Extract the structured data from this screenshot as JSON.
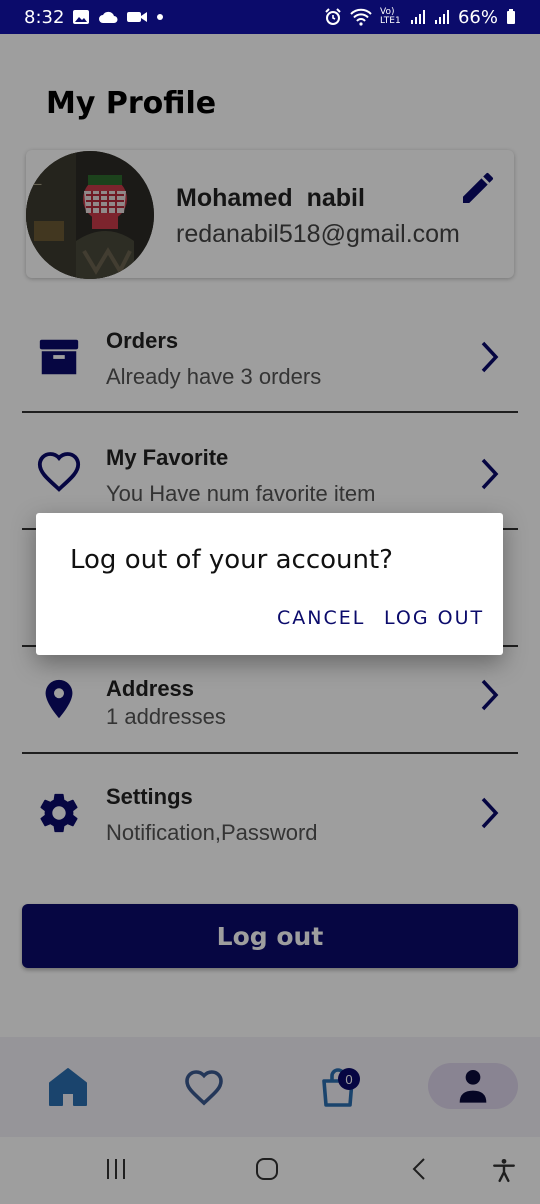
{
  "status_bar": {
    "time": "8:32",
    "battery": "66%",
    "network_label": "Vo) LTE1"
  },
  "page": {
    "title": "My Profile"
  },
  "profile": {
    "name": "Mohamed  nabil",
    "email": "redanabil518@gmail.com"
  },
  "menu": [
    {
      "title": "Orders",
      "subtitle": "Already have 3 orders",
      "icon": "archive-icon"
    },
    {
      "title": "My Favorite",
      "subtitle": "You Have num favorite item",
      "icon": "heart-outline-icon"
    },
    {
      "title": "Address",
      "subtitle": "1 addresses",
      "icon": "location-pin-icon"
    },
    {
      "title": "Settings",
      "subtitle": "Notification,Password",
      "icon": "gear-icon"
    }
  ],
  "logout_button": {
    "label": "Log out"
  },
  "bottom_nav": {
    "cart_badge": "0",
    "items": [
      "home-icon",
      "heart-icon",
      "cart-icon",
      "profile-icon"
    ]
  },
  "dialog": {
    "title": "Log out of your account?",
    "cancel_label": "CANCEL",
    "confirm_label": "LOG OUT"
  },
  "colors": {
    "primary": "#0b0b6b",
    "nav_background": "#f3f0f7",
    "nav_pill": "#ddd5ec",
    "scrim": "rgba(0,0,0,0.38)"
  }
}
